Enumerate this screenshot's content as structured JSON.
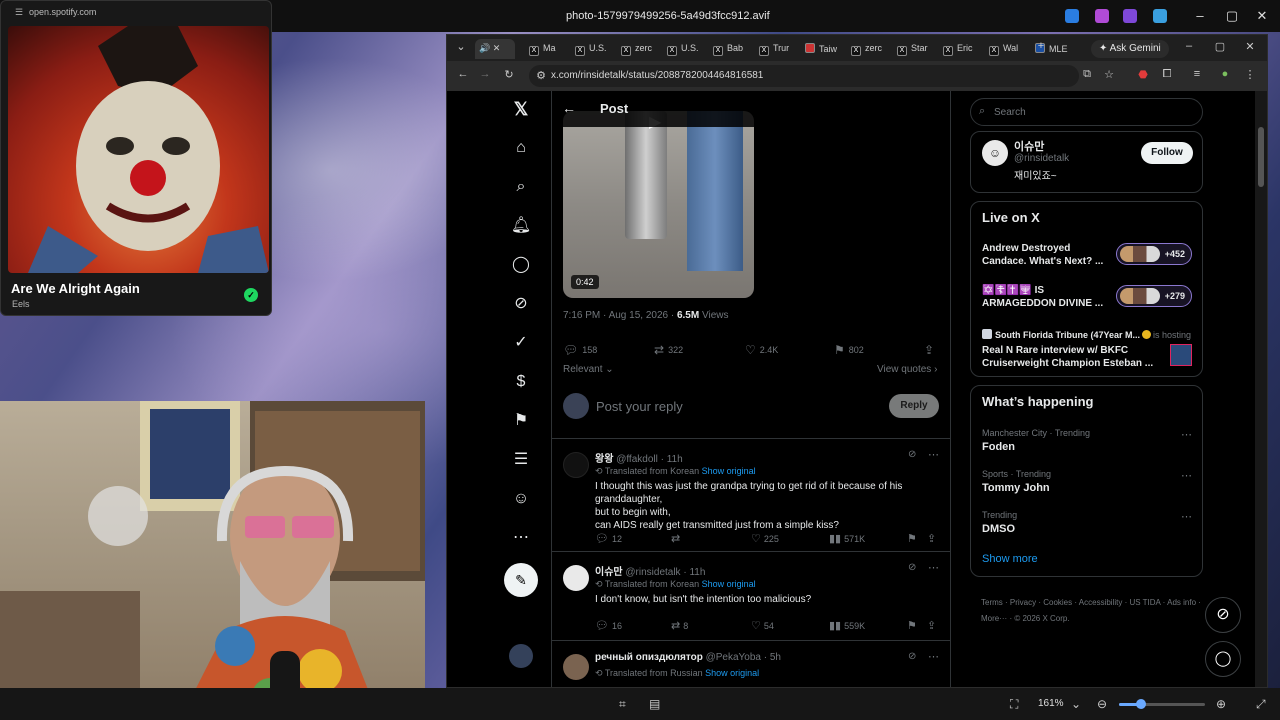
{
  "viewer": {
    "title": "photo-1579979499256-5a49d3fcc912.avif",
    "zoom": "161%"
  },
  "spotify": {
    "url": "open.spotify.com",
    "song": "Are We Alright Again",
    "artist": "Eels"
  },
  "browser": {
    "tabs": [
      {
        "label": "Ma"
      },
      {
        "label": "U.S."
      },
      {
        "label": "zerc"
      },
      {
        "label": "U.S."
      },
      {
        "label": "Bab"
      },
      {
        "label": "Trur"
      },
      {
        "label": "Taiw"
      },
      {
        "label": "zerc"
      },
      {
        "label": "Star"
      },
      {
        "label": "Eric"
      },
      {
        "label": "Wal"
      },
      {
        "label": "MLE"
      }
    ],
    "ask_gemini": "Ask Gemini",
    "url": "x.com/rinsidetalk/status/2088782004464816581"
  },
  "post": {
    "header": "Post",
    "video_duration": "0:42",
    "meta_time": "7:16 PM · Aug 15, 2026 · ",
    "views_count": "6.5M",
    "views_label": " Views",
    "stats": {
      "replies": "158",
      "reposts": "322",
      "likes": "2.4K",
      "bookmarks": "802"
    },
    "relevant": "Relevant",
    "view_quotes": "View quotes",
    "reply_placeholder": "Post your reply",
    "reply_button": "Reply"
  },
  "replies": [
    {
      "name": "왕왕",
      "handle": "@ffakdoll · 11h",
      "translated": "Translated from Korean",
      "show_original": "Show original",
      "text_lines": [
        "I thought this was just the grandpa trying to get rid of it because of his granddaughter,",
        "but to begin with,",
        "can AIDS really get transmitted just from a simple kiss?"
      ],
      "replies": "12",
      "reposts": "",
      "likes": "225",
      "views": "571K"
    },
    {
      "name": "이슈만",
      "handle": "@rinsidetalk · 11h",
      "translated": "Translated from Korean",
      "show_original": "Show original",
      "text_lines": [
        "I don't know, but isn't the intention too malicious?"
      ],
      "replies": "16",
      "reposts": "8",
      "likes": "54",
      "views": "559K"
    },
    {
      "name": "речный опиздюлятор",
      "handle": "@PekaYoba · 5h",
      "translated": "Translated from Russian",
      "show_original": "Show original"
    }
  ],
  "sidebar": {
    "search_placeholder": "Search",
    "profile": {
      "name": "이슈만",
      "handle": "@rinsidetalk",
      "bio": "재미있죠~",
      "follow": "Follow"
    },
    "live_heading": "Live on X",
    "live": [
      {
        "title": "Andrew Destroyed Candace. What's Next? ...",
        "count": "+452"
      },
      {
        "title": "✡️☦️✝️🕎 IS ARMAGEDDON DIVINE ...",
        "count": "+279"
      }
    ],
    "live_host": "South Florida Tribune (47Year M...",
    "live_hosting": "is hosting",
    "live3_title": "Real N Rare interview w/ BKFC Cruiserweight Champion Esteban ...",
    "happening_heading": "What’s happening",
    "trends": [
      {
        "category": "Manchester City · Trending",
        "name": "Foden"
      },
      {
        "category": "Sports · Trending",
        "name": "Tommy John"
      },
      {
        "category": "Trending",
        "name": "DMSO"
      }
    ],
    "show_more": "Show more",
    "footer": "Terms · Privacy · Cookies · Accessibility · US TIDA · Ads info · More··· · © 2026 X Corp."
  }
}
